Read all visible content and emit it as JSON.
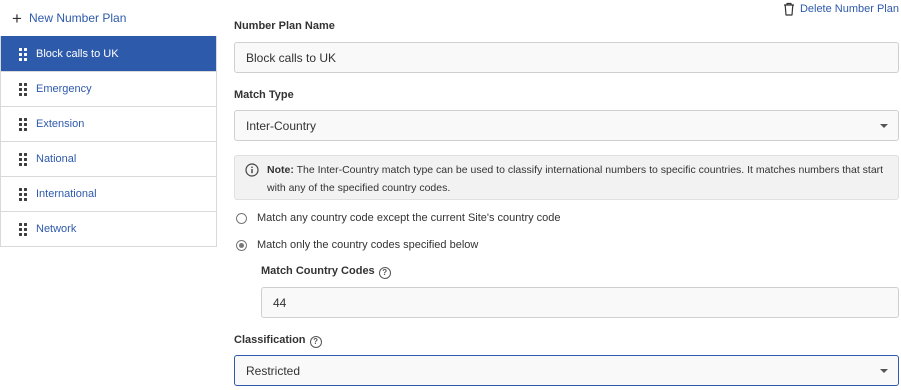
{
  "sidebar": {
    "new_plan_label": "New Number Plan",
    "items": [
      {
        "label": "Block calls to UK",
        "selected": true
      },
      {
        "label": "Emergency"
      },
      {
        "label": "Extension"
      },
      {
        "label": "National"
      },
      {
        "label": "International"
      },
      {
        "label": "Network"
      }
    ]
  },
  "form": {
    "delete_label": "Delete Number Plan",
    "name_label": "Number Plan Name",
    "name_value": "Block calls to UK",
    "match_type_label": "Match Type",
    "match_type_value": "Inter-Country",
    "note_prefix": "Note:",
    "note_text": " The Inter-Country match type can be used to classify international numbers to specific countries. It matches numbers that start with any of the specified country codes.",
    "radio_options": [
      {
        "label": "Match any country code except the current Site's country code",
        "checked": false
      },
      {
        "label": "Match only the country codes specified below",
        "checked": true
      }
    ],
    "country_codes_label": "Match Country Codes",
    "country_codes_value": "44",
    "classification_label": "Classification",
    "classification_value": "Restricted",
    "help_glyph": "?"
  },
  "colors": {
    "accent": "#2e5aac",
    "selected_text": "#ffffff"
  }
}
